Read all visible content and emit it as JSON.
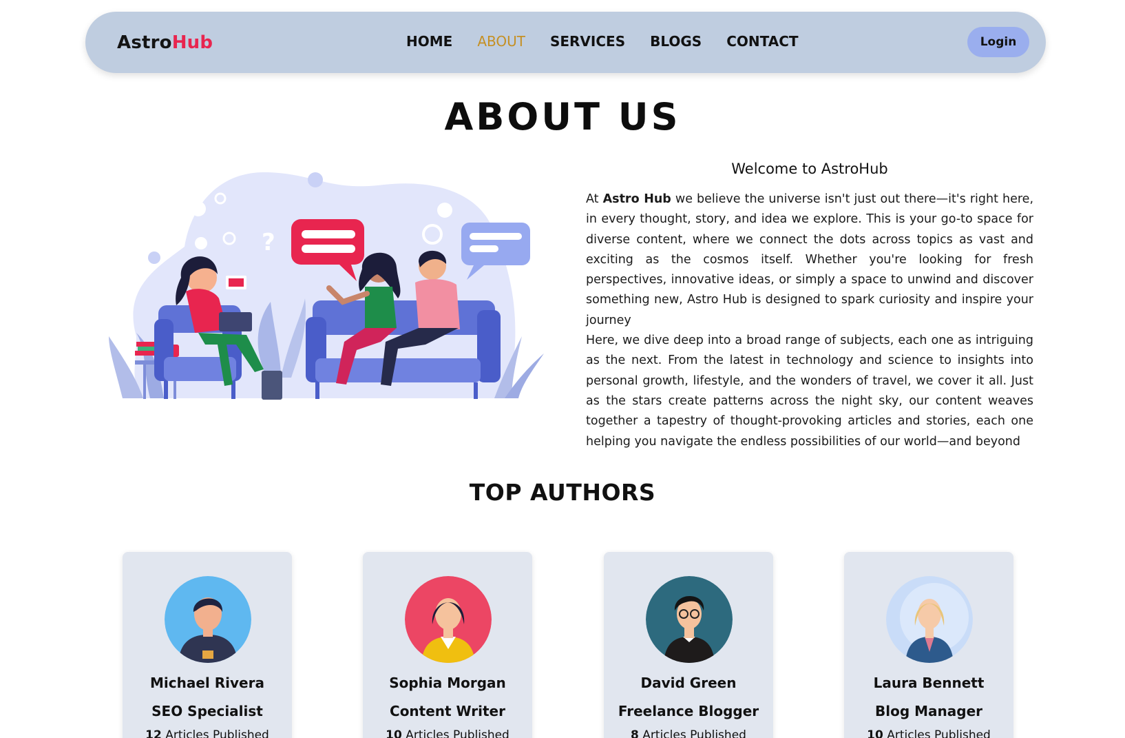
{
  "navbar": {
    "brand_part1": "Astro",
    "brand_part2": "Hub",
    "links": [
      {
        "label": "HOME",
        "active": false
      },
      {
        "label": "ABOUT",
        "active": true
      },
      {
        "label": "SERVICES",
        "active": false
      },
      {
        "label": "BLOGS",
        "active": false
      },
      {
        "label": "CONTACT",
        "active": false
      }
    ],
    "login_label": "Login"
  },
  "about": {
    "title": "ABOUT US",
    "welcome_title": "Welcome to AstroHub",
    "para1_prefix": "At ",
    "para1_bold": "Astro Hub",
    "para1_rest": " we believe the universe isn't just out there—it's right here, in every thought, story, and idea we explore. This is your go-to space for diverse content, where we connect the dots across topics as vast and exciting as the cosmos itself. Whether you're looking for fresh perspectives, innovative ideas, or simply a space to unwind and discover something new, Astro Hub is designed to spark curiosity and inspire your journey",
    "para2": "Here, we dive deep into a broad range of subjects, each one as intriguing as the next. From the latest in technology and science to insights into personal growth, lifestyle, and the wonders of travel, we cover it all. Just as the stars create patterns across the night sky, our content weaves together a tapestry of thought-provoking articles and stories, each one helping you navigate the endless possibilities of our world—and beyond"
  },
  "top_authors": {
    "title": "TOP AUTHORS",
    "authors": [
      {
        "name": "Michael Rivera",
        "role": "SEO Specialist",
        "articles_count": "12",
        "articles_label": "Articles Published",
        "avatar": "man-hoodie-avatar-icon",
        "avatar_bg": "#5fb8f0"
      },
      {
        "name": "Sophia Morgan",
        "role": "Content Writer",
        "articles_count": "10",
        "articles_label": "Articles Published",
        "avatar": "woman-yellow-top-avatar-icon",
        "avatar_bg": "#ec4664"
      },
      {
        "name": "David Green",
        "role": "Freelance Blogger",
        "articles_count": "8",
        "articles_label": "Articles Published",
        "avatar": "man-glasses-avatar-icon",
        "avatar_bg": "#2d6a7e"
      },
      {
        "name": "Laura Bennett",
        "role": "Blog Manager",
        "articles_count": "10",
        "articles_label": "Articles Published",
        "avatar": "woman-blonde-avatar-icon",
        "avatar_bg": "#c9dcf8"
      }
    ]
  },
  "colors": {
    "navbar_bg": "#bfcde0",
    "brand_accent": "#e8254f",
    "active_link": "#c59024",
    "login_bg": "#9aaeee",
    "card_bg": "#e1e6ef"
  }
}
